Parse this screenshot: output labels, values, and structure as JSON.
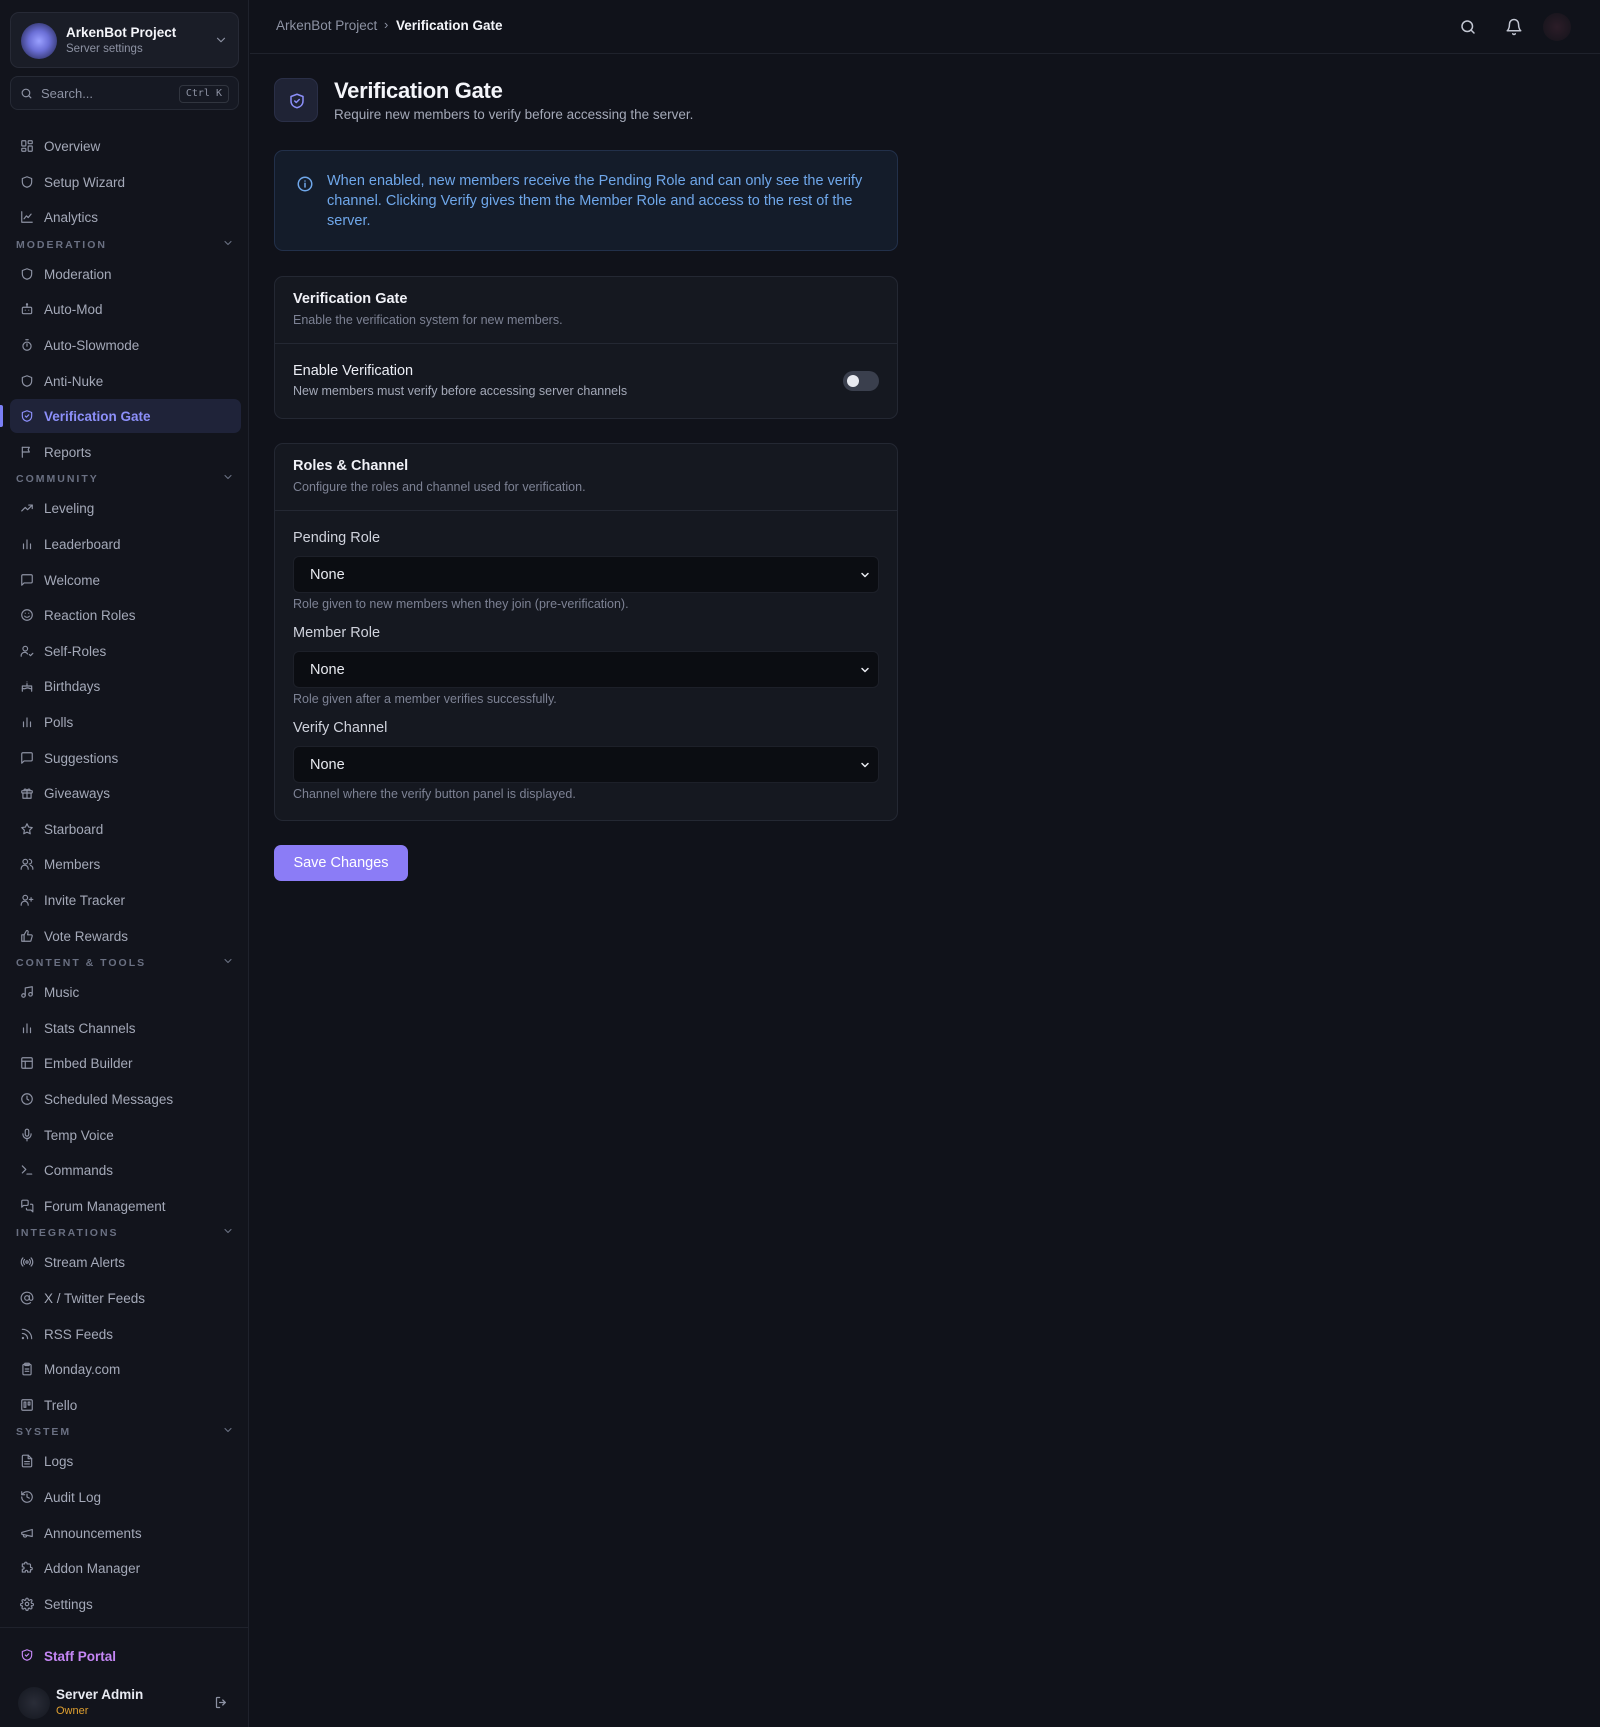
{
  "server": {
    "name": "ArkenBot Project",
    "subtitle": "Server settings"
  },
  "search": {
    "placeholder": "Search...",
    "shortcut": "Ctrl K"
  },
  "sidebar": {
    "top_items": [
      {
        "label": "Overview",
        "icon": "grid-icon"
      },
      {
        "label": "Setup Wizard",
        "icon": "shield-icon"
      },
      {
        "label": "Analytics",
        "icon": "chart-line-icon"
      }
    ],
    "sections": [
      {
        "title": "MODERATION",
        "items": [
          {
            "label": "Moderation",
            "icon": "shield-icon"
          },
          {
            "label": "Auto-Mod",
            "icon": "bot-icon"
          },
          {
            "label": "Auto-Slowmode",
            "icon": "timer-icon"
          },
          {
            "label": "Anti-Nuke",
            "icon": "shield-icon"
          },
          {
            "label": "Verification Gate",
            "icon": "shield-check-icon",
            "active": true
          },
          {
            "label": "Reports",
            "icon": "flag-icon"
          }
        ]
      },
      {
        "title": "COMMUNITY",
        "items": [
          {
            "label": "Leveling",
            "icon": "trending-up-icon"
          },
          {
            "label": "Leaderboard",
            "icon": "bar-chart-icon"
          },
          {
            "label": "Welcome",
            "icon": "message-icon"
          },
          {
            "label": "Reaction Roles",
            "icon": "smile-icon"
          },
          {
            "label": "Self-Roles",
            "icon": "user-check-icon"
          },
          {
            "label": "Birthdays",
            "icon": "cake-icon"
          },
          {
            "label": "Polls",
            "icon": "bar-chart-icon"
          },
          {
            "label": "Suggestions",
            "icon": "message-icon"
          },
          {
            "label": "Giveaways",
            "icon": "gift-icon"
          },
          {
            "label": "Starboard",
            "icon": "star-icon"
          },
          {
            "label": "Members",
            "icon": "users-icon"
          },
          {
            "label": "Invite Tracker",
            "icon": "user-plus-icon"
          },
          {
            "label": "Vote Rewards",
            "icon": "thumbs-up-icon"
          }
        ]
      },
      {
        "title": "CONTENT & TOOLS",
        "items": [
          {
            "label": "Music",
            "icon": "music-icon"
          },
          {
            "label": "Stats Channels",
            "icon": "bar-chart-icon"
          },
          {
            "label": "Embed Builder",
            "icon": "layout-icon"
          },
          {
            "label": "Scheduled Messages",
            "icon": "clock-icon"
          },
          {
            "label": "Temp Voice",
            "icon": "mic-icon"
          },
          {
            "label": "Commands",
            "icon": "terminal-icon"
          },
          {
            "label": "Forum Management",
            "icon": "forum-icon"
          }
        ]
      },
      {
        "title": "INTEGRATIONS",
        "items": [
          {
            "label": "Stream Alerts",
            "icon": "radio-icon"
          },
          {
            "label": "X / Twitter Feeds",
            "icon": "at-sign-icon"
          },
          {
            "label": "RSS Feeds",
            "icon": "rss-icon"
          },
          {
            "label": "Monday.com",
            "icon": "clipboard-icon"
          },
          {
            "label": "Trello",
            "icon": "trello-icon"
          }
        ]
      },
      {
        "title": "SYSTEM",
        "items": [
          {
            "label": "Logs",
            "icon": "file-text-icon"
          },
          {
            "label": "Audit Log",
            "icon": "history-icon"
          },
          {
            "label": "Announcements",
            "icon": "megaphone-icon"
          },
          {
            "label": "Addon Manager",
            "icon": "puzzle-icon"
          },
          {
            "label": "Settings",
            "icon": "gear-icon"
          }
        ]
      }
    ],
    "staff_portal": "Staff Portal",
    "user": {
      "name": "Server Admin",
      "role": "Owner"
    }
  },
  "breadcrumb": {
    "parent": "ArkenBot Project",
    "separator": "›",
    "current": "Verification Gate"
  },
  "page": {
    "title": "Verification Gate",
    "subtitle": "Require new members to verify before accessing the server.",
    "info": "When enabled, new members receive the Pending Role and can only see the verify channel. Clicking Verify gives them the Member Role and access to the rest of the server."
  },
  "gate_card": {
    "title": "Verification Gate",
    "subtitle": "Enable the verification system for new members.",
    "toggle_label": "Enable Verification",
    "toggle_help": "New members must verify before accessing server channels",
    "enabled": false
  },
  "roles_card": {
    "title": "Roles & Channel",
    "subtitle": "Configure the roles and channel used for verification.",
    "pending_role": {
      "label": "Pending Role",
      "value": "None",
      "help": "Role given to new members when they join (pre-verification)."
    },
    "member_role": {
      "label": "Member Role",
      "value": "None",
      "help": "Role given after a member verifies successfully."
    },
    "verify_channel": {
      "label": "Verify Channel",
      "value": "None",
      "help": "Channel where the verify button panel is displayed."
    }
  },
  "save_label": "Save Changes",
  "colors": {
    "accent": "#8b7cf6",
    "active_nav": "#8c8ff9",
    "info_text": "#6fa7ea",
    "staff": "#c486f5",
    "owner": "#e0a030"
  }
}
